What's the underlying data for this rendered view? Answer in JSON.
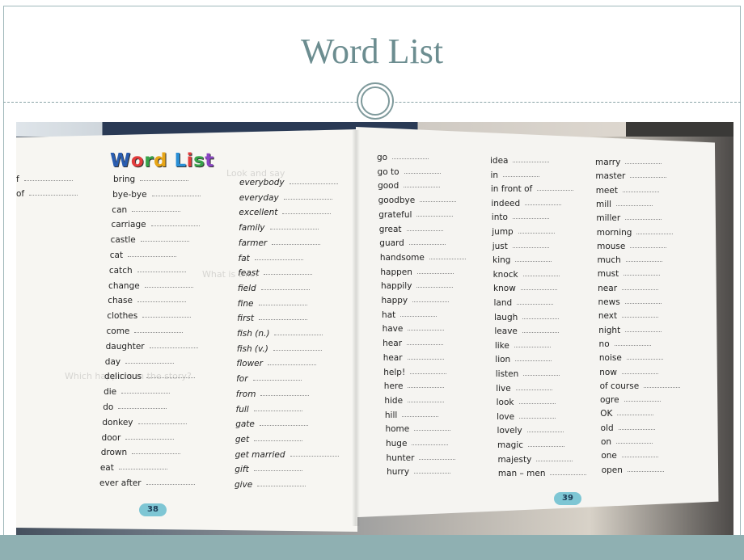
{
  "slide": {
    "title": "Word List"
  },
  "book": {
    "heading": [
      "W",
      "o",
      "r",
      "d",
      " ",
      "L",
      "i",
      "s",
      "t"
    ],
    "heading_colors": [
      "#2a5db0",
      "#e23b3b",
      "#37a34a",
      "#e7a516",
      "#ffffff",
      "#2a8fd6",
      "#e23b3b",
      "#37a34a",
      "#8a46c4"
    ],
    "left_page_number": "38",
    "right_page_number": "39",
    "left_partial": [
      "f",
      "of"
    ],
    "left_col1": [
      "bring",
      "bye-bye",
      "can",
      "carriage",
      "castle",
      "cat",
      "catch",
      "change",
      "chase",
      "clothes",
      "come",
      "daughter",
      "day",
      "delicious",
      "die",
      "do",
      "donkey",
      "door",
      "drown",
      "eat",
      "ever after"
    ],
    "left_col2": [
      "everybody",
      "everyday",
      "excellent",
      "family",
      "farmer",
      "fat",
      "feast",
      "field",
      "fine",
      "first",
      "fish (n.)",
      "fish (v.)",
      "flower",
      "for",
      "from",
      "full",
      "gate",
      "get",
      "get married",
      "gift",
      "give"
    ],
    "right_col1": [
      "go",
      "go to",
      "good",
      "goodbye",
      "grateful",
      "great",
      "guard",
      "handsome",
      "happen",
      "happily",
      "happy",
      "hat",
      "have",
      "hear",
      "hear",
      "help!",
      "here",
      "hide",
      "hill",
      "home",
      "huge",
      "hunter",
      "hurry"
    ],
    "right_col2": [
      "idea",
      "in",
      "in front of",
      "indeed",
      "into",
      "jump",
      "just",
      "king",
      "knock",
      "know",
      "land",
      "laugh",
      "leave",
      "like",
      "lion",
      "listen",
      "live",
      "look",
      "love",
      "lovely",
      "magic",
      "majesty",
      "man – men"
    ],
    "right_col3": [
      "marry",
      "master",
      "meet",
      "mill",
      "miller",
      "morning",
      "mouse",
      "much",
      "must",
      "near",
      "news",
      "next",
      "night",
      "no",
      "noise",
      "now",
      "of course",
      "ogre",
      "OK",
      "old",
      "on",
      "one",
      "open"
    ],
    "faint_text": [
      "Look and say",
      "What is this?",
      "Which happens in the story?"
    ]
  }
}
